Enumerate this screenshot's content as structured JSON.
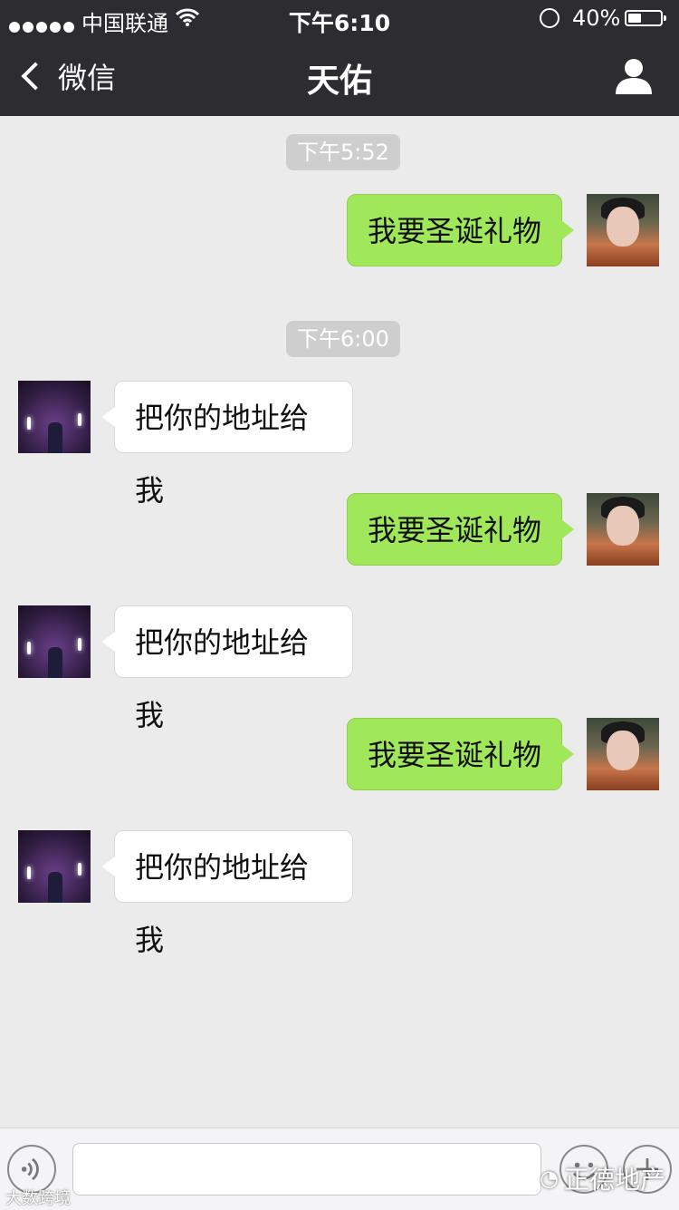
{
  "status_bar": {
    "carrier": "中国联通",
    "time": "下午6:10",
    "battery_percent": "40%",
    "battery_level": 0.4
  },
  "nav": {
    "back_label": "微信",
    "title": "天佑"
  },
  "messages": [
    {
      "type": "timestamp",
      "text": "下午5:52"
    },
    {
      "type": "outgoing",
      "text": "我要圣诞礼物"
    },
    {
      "type": "timestamp",
      "text": "下午6:00"
    },
    {
      "type": "incoming",
      "text": "把你的地址给我"
    },
    {
      "type": "outgoing",
      "text": "我要圣诞礼物"
    },
    {
      "type": "incoming",
      "text": "把你的地址给我"
    },
    {
      "type": "outgoing",
      "text": "我要圣诞礼物"
    },
    {
      "type": "incoming",
      "text": "把你的地址给我"
    }
  ],
  "input": {
    "value": "",
    "placeholder": ""
  },
  "watermarks": {
    "left": "大数跨境",
    "right": "正德地产"
  },
  "colors": {
    "header_bg": "#2d2d31",
    "chat_bg": "#ebebeb",
    "outgoing_bubble": "#a0e75a",
    "incoming_bubble": "#ffffff",
    "timestamp_bg": "#cecece"
  }
}
